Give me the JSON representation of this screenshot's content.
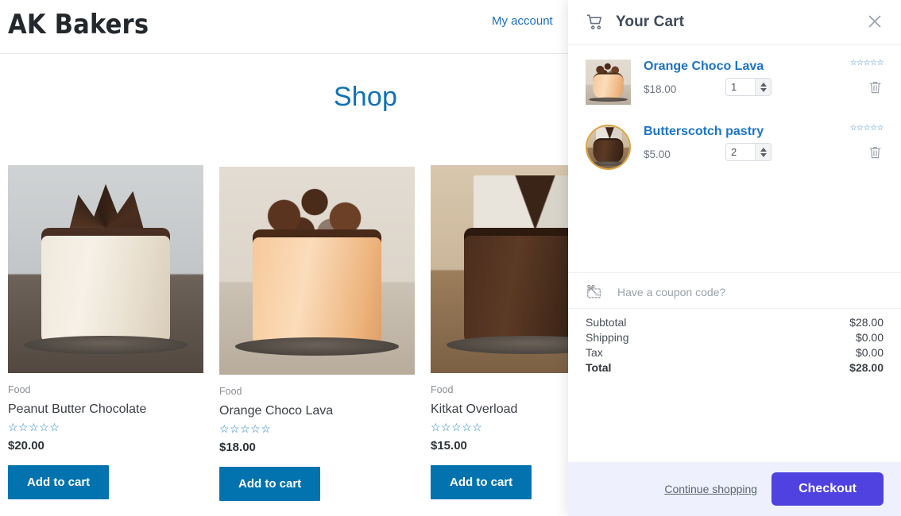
{
  "header": {
    "brand": "AK Bakers",
    "account_link": "My account"
  },
  "shop": {
    "title": "Shop",
    "products": [
      {
        "category": "Food",
        "name": "Peanut Butter Chocolate",
        "stars": "☆☆☆☆☆",
        "price": "$20.00",
        "add_label": "Add to cart",
        "image_name": "peanut-butter-chocolate-cake"
      },
      {
        "category": "Food",
        "name": "Orange Choco Lava",
        "stars": "☆☆☆☆☆",
        "price": "$18.00",
        "add_label": "Add to cart",
        "image_name": "orange-choco-lava-cake"
      },
      {
        "category": "Food",
        "name": "Kitkat Overload",
        "stars": "☆☆☆☆☆",
        "price": "$15.00",
        "add_label": "Add to cart",
        "image_name": "kitkat-overload-cake"
      }
    ]
  },
  "cart": {
    "title": "Your Cart",
    "cart_icon": "shopping-cart-icon",
    "close_icon": "close-icon",
    "items": [
      {
        "name": "Orange Choco Lava",
        "price": "$18.00",
        "quantity": "1",
        "stars": "☆☆☆☆☆",
        "image_name": "orange-choco-lava-thumb",
        "remove_icon": "trash-icon"
      },
      {
        "name": "Butterscotch pastry",
        "price": "$5.00",
        "quantity": "2",
        "stars": "☆☆☆☆☆",
        "image_name": "butterscotch-pastry-thumb",
        "remove_icon": "trash-icon"
      }
    ],
    "coupon": {
      "icon": "coupon-scissors-icon",
      "placeholder": "Have a coupon code?",
      "value": ""
    },
    "totals": [
      {
        "label": "Subtotal",
        "value": "$28.00"
      },
      {
        "label": "Shipping",
        "value": "$0.00"
      },
      {
        "label": "Tax",
        "value": "$0.00"
      },
      {
        "label": "Total",
        "value": "$28.00"
      }
    ],
    "footer": {
      "continue_label": "Continue shopping",
      "checkout_label": "Checkout"
    }
  },
  "colors": {
    "brand_blue": "#1271b5",
    "add_to_cart_blue": "#0273ae",
    "link_blue": "#1b74c4",
    "checkout_purple": "#4f42e0",
    "footer_bg": "#eef1fd",
    "star_blue": "#2f86d4"
  }
}
